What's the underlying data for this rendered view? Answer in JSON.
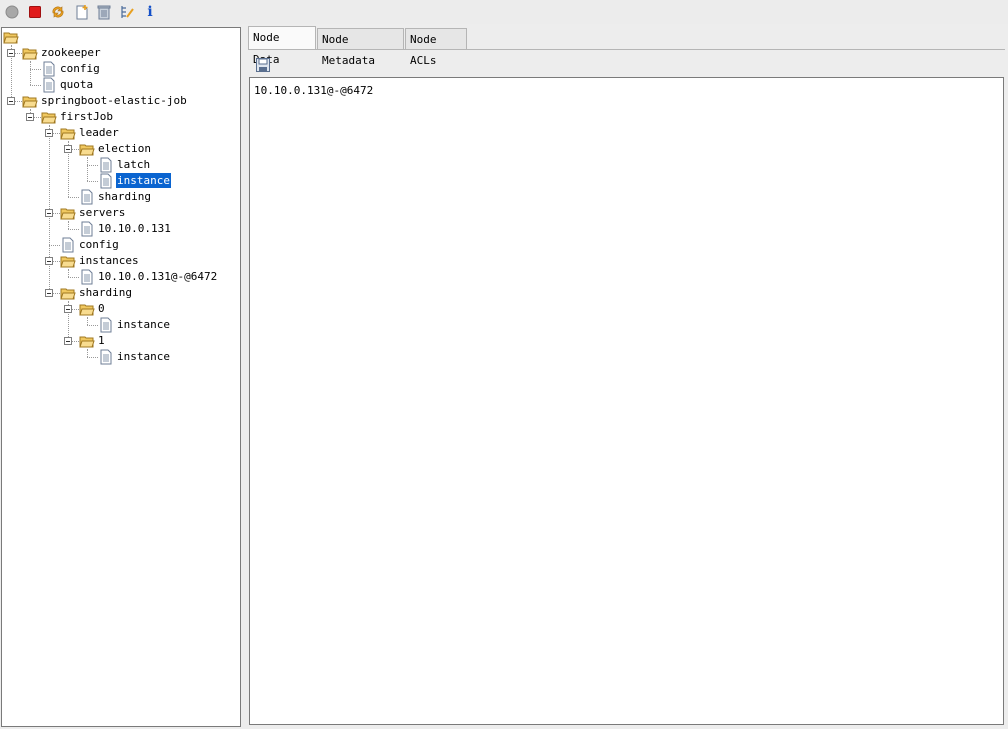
{
  "toolbar": {
    "buttons": [
      {
        "name": "connect-icon"
      },
      {
        "name": "disconnect-icon"
      },
      {
        "name": "refresh-icon"
      },
      {
        "name": "add-node-icon"
      },
      {
        "name": "delete-node-icon"
      },
      {
        "name": "change-log-level-icon"
      },
      {
        "name": "info-icon"
      }
    ]
  },
  "tree": {
    "selected": "instance",
    "nodes": [
      {
        "label": "",
        "type": "folder",
        "depth": 0,
        "expanded": true
      },
      {
        "label": "zookeeper",
        "type": "folder",
        "depth": 1,
        "expanded": true
      },
      {
        "label": "config",
        "type": "file",
        "depth": 2
      },
      {
        "label": "quota",
        "type": "file",
        "depth": 2
      },
      {
        "label": "springboot-elastic-job",
        "type": "folder",
        "depth": 1,
        "expanded": true
      },
      {
        "label": "firstJob",
        "type": "folder",
        "depth": 2,
        "expanded": true
      },
      {
        "label": "leader",
        "type": "folder",
        "depth": 3,
        "expanded": true
      },
      {
        "label": "election",
        "type": "folder",
        "depth": 4,
        "expanded": true
      },
      {
        "label": "latch",
        "type": "file",
        "depth": 5
      },
      {
        "label": "instance",
        "type": "file",
        "depth": 5,
        "selected": true
      },
      {
        "label": "sharding",
        "type": "file",
        "depth": 4
      },
      {
        "label": "servers",
        "type": "folder",
        "depth": 3,
        "expanded": true
      },
      {
        "label": "10.10.0.131",
        "type": "file",
        "depth": 4
      },
      {
        "label": "config",
        "type": "file",
        "depth": 3
      },
      {
        "label": "instances",
        "type": "folder",
        "depth": 3,
        "expanded": true
      },
      {
        "label": "10.10.0.131@-@6472",
        "type": "file",
        "depth": 4
      },
      {
        "label": "sharding",
        "type": "folder",
        "depth": 3,
        "expanded": true
      },
      {
        "label": "0",
        "type": "folder",
        "depth": 4,
        "expanded": true
      },
      {
        "label": "instance",
        "type": "file",
        "depth": 5
      },
      {
        "label": "1",
        "type": "folder",
        "depth": 4,
        "expanded": true
      },
      {
        "label": "instance",
        "type": "file",
        "depth": 5
      }
    ]
  },
  "tabs": [
    {
      "label": "Node Data",
      "active": true
    },
    {
      "label": "Node Metadata",
      "active": false
    },
    {
      "label": "Node ACLs",
      "active": false
    }
  ],
  "node_data": {
    "save_icon": "save-icon",
    "content": "10.10.0.131@-@6472"
  },
  "colors": {
    "selection": "#0a64d0",
    "folder": "#f5d27a",
    "stop": "#e01b1b",
    "info": "#1450c8"
  }
}
